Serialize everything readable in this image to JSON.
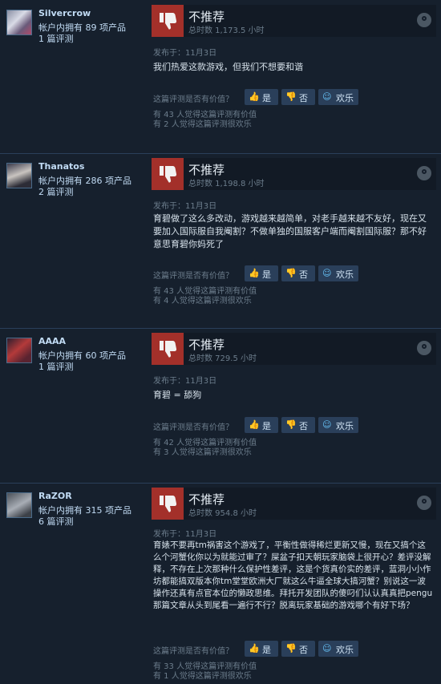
{
  "reviews": [
    {
      "author": "Silvercrow",
      "owned": "帐户内拥有 89 项产品",
      "review_count": "1 篇评测",
      "recommendation": "不推荐",
      "hours": "总时数 1,173.5 小时",
      "posted": "发布于：11月3日",
      "text": "我们热爱这款游戏，但我们不想要和谐",
      "helpful_question": "这篇评测是否有价值？",
      "btn_yes": "是",
      "btn_no": "否",
      "btn_funny": "欢乐",
      "helpful_count": "有 43 人觉得这篇评测有价值",
      "funny_count": "有 2 人觉得这篇评测很欢乐"
    },
    {
      "author": "Thanatos",
      "owned": "帐户内拥有 286 项产品",
      "review_count": "2 篇评测",
      "recommendation": "不推荐",
      "hours": "总时数 1,198.8 小时",
      "posted": "发布于：11月3日",
      "text": "育碧做了这么多改动，游戏越来越简单，对老手越来越不友好，现在又要加入国际服自我阉割？不做单独的国服客户端而阉割国际服？那不好意思育碧你妈死了",
      "helpful_question": "这篇评测是否有价值？",
      "btn_yes": "是",
      "btn_no": "否",
      "btn_funny": "欢乐",
      "helpful_count": "有 43 人觉得这篇评测有价值",
      "funny_count": "有 4 人觉得这篇评测很欢乐"
    },
    {
      "author": "AAAA",
      "owned": "帐户内拥有 60 项产品",
      "review_count": "1 篇评测",
      "recommendation": "不推荐",
      "hours": "总时数 729.5 小时",
      "posted": "发布于：11月3日",
      "text": "育碧 = 舔狗",
      "helpful_question": "这篇评测是否有价值？",
      "btn_yes": "是",
      "btn_no": "否",
      "btn_funny": "欢乐",
      "helpful_count": "有 42 人觉得这篇评测有价值",
      "funny_count": "有 3 人觉得这篇评测很欢乐"
    },
    {
      "author": "RaZOR",
      "owned": "帐户内拥有 315 项产品",
      "review_count": "6 篇评测",
      "recommendation": "不推荐",
      "hours": "总时数 954.8 小时",
      "posted": "发布于：11月3日",
      "text": "育婊不要再tm祸害这个游戏了，平衡性做得稀烂更新又慢，现在又搞个这么个河蟹化你以为就能过审了？屎盆子扣天朝玩家脑袋上很开心？差评没解释，不存在上次那种什么保护性差评，这是个货真价实的差评，蓝洞小小作坊都能搞双版本你tm堂堂欧洲大厂就这么牛逼全球大搞河蟹？别说这一波操作还真有点官本位的懒政思维。拜托开发团队的傻叼们认认真真把pengu那篇文章从头到尾看一遍行不行？脱离玩家基础的游戏哪个有好下场？",
      "helpful_question": "这篇评测是否有价值？",
      "btn_yes": "是",
      "btn_no": "否",
      "btn_funny": "欢乐",
      "helpful_count": "有 33 人觉得这篇评测有价值",
      "funny_count": "有 1 人觉得这篇评测很欢乐"
    }
  ]
}
